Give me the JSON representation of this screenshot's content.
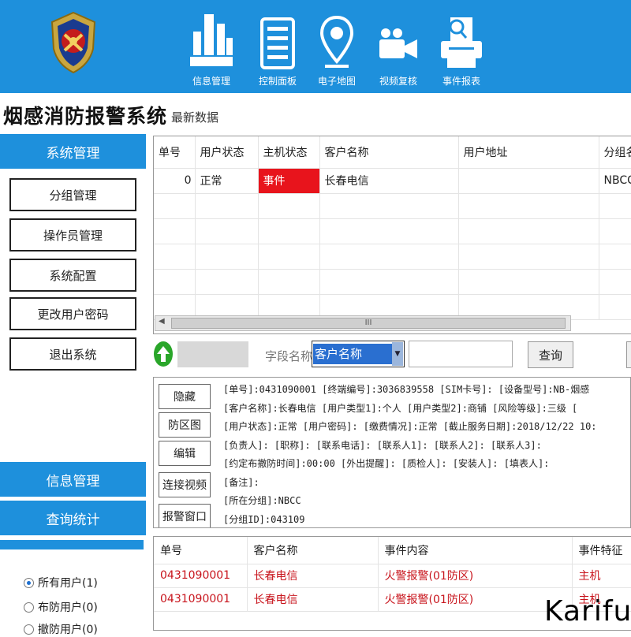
{
  "nav": {
    "items": [
      {
        "label": "信息管理",
        "icon": "building-icon"
      },
      {
        "label": "控制面板",
        "icon": "panel-icon"
      },
      {
        "label": "电子地图",
        "icon": "map-pin-icon"
      },
      {
        "label": "视频复核",
        "icon": "video-camera-icon"
      },
      {
        "label": "事件报表",
        "icon": "printer-icon"
      }
    ]
  },
  "app_title": "烟感消防报警系统",
  "sidebar": {
    "system_header": "系统管理",
    "buttons": [
      "分组管理",
      "操作员管理",
      "系统配置",
      "更改用户密码",
      "退出系统"
    ],
    "info_header": "信息管理",
    "query_header": "查询统计",
    "filters": [
      {
        "label": "所有用户(1)",
        "selected": true
      },
      {
        "label": "布防用户(0)",
        "selected": false
      },
      {
        "label": "撤防用户(0)",
        "selected": false
      }
    ]
  },
  "main": {
    "latest_label": "最新数据",
    "grid": {
      "columns": [
        "单号",
        "用户状态",
        "主机状态",
        "客户名称",
        "用户地址",
        "分组名"
      ],
      "rows": [
        [
          "0",
          "正常",
          "事件",
          "长春电信",
          "",
          "NBCC"
        ]
      ]
    },
    "scroll_thumb": "III",
    "search": {
      "field_label": "字段名称",
      "field_value": "客户名称",
      "query_label": "查询"
    },
    "actions": [
      "隐藏",
      "防区图",
      "编辑",
      "连接视频",
      "报警窗口"
    ],
    "detail_lines": [
      "[单号]:0431090001   [终端编号]:3036839558   [SIM卡号]:   [设备型号]:NB-烟感",
      "[客户名称]:长春电信   [用户类型1]:个人   [用户类型2]:商铺   [风险等级]:三级   [",
      "[用户状态]:正常   [用户密码]:   [缴费情况]:正常   [截止服务日期]:2018/12/22 10:",
      "[负责人]:   [职称]:   [联系电话]:   [联系人1]:   [联系人2]:   [联系人3]:",
      "[约定布撤防时间]:00:00   [外出提醒]:   [质检人]:   [安装人]:   [填表人]:",
      "[备注]:",
      "[所在分组]:NBCC",
      "[分组ID]:043109"
    ],
    "events": {
      "columns": [
        "单号",
        "客户名称",
        "事件内容",
        "事件特征"
      ],
      "rows": [
        [
          "0431090001",
          "长春电信",
          "火警报警(01防区)",
          "主机"
        ],
        [
          "0431090001",
          "长春电信",
          "火警报警(01防区)",
          "主机"
        ]
      ]
    }
  },
  "watermark": "Kariful",
  "colors": {
    "accent": "#1e90dc",
    "alarm": "#e8141c",
    "event_text": "#c8141c"
  }
}
